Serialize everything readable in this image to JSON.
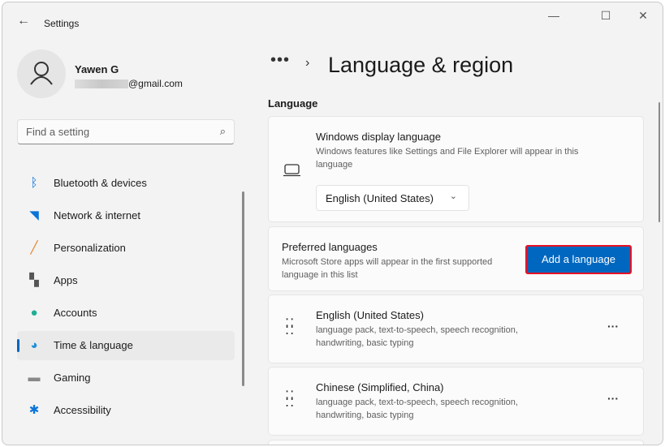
{
  "window": {
    "title": "Settings",
    "minimize": "—",
    "maximize": "☐",
    "close": "✕"
  },
  "user": {
    "name": "Yawen G",
    "email_suffix": "@gmail.com"
  },
  "search": {
    "placeholder": "Find a setting"
  },
  "nav": [
    {
      "label": "Bluetooth & devices",
      "icon": "bluetooth-icon",
      "color": "#0a74d8"
    },
    {
      "label": "Network & internet",
      "icon": "wifi-icon",
      "color": "#0a74d8"
    },
    {
      "label": "Personalization",
      "icon": "brush-icon",
      "color": "#e8822a"
    },
    {
      "label": "Apps",
      "icon": "apps-icon",
      "color": "#555555"
    },
    {
      "label": "Accounts",
      "icon": "accounts-icon",
      "color": "#1fae94"
    },
    {
      "label": "Time & language",
      "icon": "time-language-icon",
      "color": "#1f8fd8",
      "selected": true
    },
    {
      "label": "Gaming",
      "icon": "gaming-icon",
      "color": "#888888"
    },
    {
      "label": "Accessibility",
      "icon": "accessibility-icon",
      "color": "#0a74d8"
    }
  ],
  "breadcrumb": {
    "more": "•••",
    "title": "Language & region"
  },
  "section": "Language",
  "display_language": {
    "title": "Windows display language",
    "desc": "Windows features like Settings and File Explorer will appear in this language",
    "value": "English (United States)"
  },
  "preferred": {
    "title": "Preferred languages",
    "desc": "Microsoft Store apps will appear in the first supported language in this list",
    "button": "Add a language"
  },
  "languages": [
    {
      "name": "English (United States)",
      "features": "language pack, text-to-speech, speech recognition, handwriting, basic typing"
    },
    {
      "name": "Chinese (Simplified, China)",
      "features": "language pack, text-to-speech, speech recognition, handwriting, basic typing"
    }
  ],
  "accent": "#0067c0"
}
